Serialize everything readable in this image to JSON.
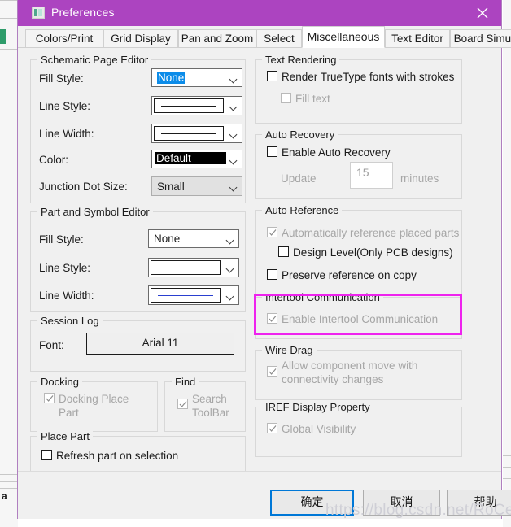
{
  "window": {
    "title": "Preferences",
    "icon": "window-app-icon",
    "close_label": "✕",
    "titlebar_color": "#ac44c0",
    "border_color": "#b07fc0"
  },
  "tabs": [
    {
      "label": "Colors/Print",
      "active": false
    },
    {
      "label": "Grid Display",
      "active": false
    },
    {
      "label": "Pan and Zoom",
      "active": false
    },
    {
      "label": "Select",
      "active": false
    },
    {
      "label": "Miscellaneous",
      "active": true
    },
    {
      "label": "Text Editor",
      "active": false
    },
    {
      "label": "Board Simulation",
      "active": false
    }
  ],
  "schematic_page_editor": {
    "caption": "Schematic Page Editor",
    "fill_style": {
      "label": "Fill Style:",
      "value": "None",
      "style": "selected-blue"
    },
    "line_style": {
      "label": "Line Style:",
      "value": "line-sample"
    },
    "line_width": {
      "label": "Line Width:",
      "value": "line-sample"
    },
    "color": {
      "label": "Color:",
      "value": "Default",
      "style": "black-swatch"
    },
    "junction_dot_size": {
      "label": "Junction Dot Size:",
      "value": "Small",
      "disabled": true
    }
  },
  "part_symbol_editor": {
    "caption": "Part and Symbol Editor",
    "fill_style": {
      "label": "Fill Style:",
      "value": "None"
    },
    "line_style": {
      "label": "Line Style:",
      "value": "line-sample-blue"
    },
    "line_width": {
      "label": "Line Width:",
      "value": "line-sample-blue"
    }
  },
  "session_log": {
    "caption": "Session Log",
    "font_label": "Font:",
    "font_value": "Arial 11"
  },
  "docking": {
    "caption": "Docking",
    "checkbox": {
      "label": "Docking Place Part",
      "checked": true,
      "disabled": true
    }
  },
  "find": {
    "caption": "Find",
    "checkbox": {
      "label": "Search ToolBar",
      "checked": true,
      "disabled": true
    }
  },
  "place_part": {
    "caption": "Place Part",
    "checkbox": {
      "label": "Refresh part on selection",
      "checked": false,
      "disabled": false
    }
  },
  "text_rendering": {
    "caption": "Text Rendering",
    "render_truetype": {
      "label": "Render TrueType fonts with strokes",
      "checked": false,
      "disabled": false
    },
    "fill_text": {
      "label": "Fill text",
      "checked": false,
      "disabled": true
    }
  },
  "auto_recovery": {
    "caption": "Auto Recovery",
    "enable": {
      "label": "Enable Auto Recovery",
      "checked": false,
      "disabled": false
    },
    "update_label": "Update",
    "interval_value": "15",
    "minutes_label": "minutes"
  },
  "auto_reference": {
    "caption": "Auto Reference",
    "auto_ref_parts": {
      "label": "Automatically reference placed parts",
      "checked": true,
      "disabled": true
    },
    "design_level": {
      "label": "Design Level(Only PCB designs)",
      "checked": false,
      "disabled": false
    },
    "preserve_reference": {
      "label": "Preserve reference on copy",
      "checked": false,
      "disabled": false
    }
  },
  "intertool_communication": {
    "caption": "Intertool Communication",
    "enable": {
      "label": "Enable Intertool Communication",
      "checked": true,
      "disabled": true
    },
    "highlight_color": "#ee23ee"
  },
  "wire_drag": {
    "caption": "Wire Drag",
    "allow_move": {
      "label": "Allow component move with connectivity changes",
      "checked": true,
      "disabled": true
    }
  },
  "iref_display_property": {
    "caption": "IREF Display Property",
    "global_visibility": {
      "label": "Global Visibility",
      "checked": true,
      "disabled": true
    }
  },
  "footer": {
    "ok_label": "确定",
    "cancel_label": "取消",
    "help_label": "帮助",
    "focus_color": "#0078d7"
  },
  "watermark": {
    "text": "https://blog.csdn.net/RoCelay"
  },
  "desktop": {
    "side_letter": "a"
  }
}
